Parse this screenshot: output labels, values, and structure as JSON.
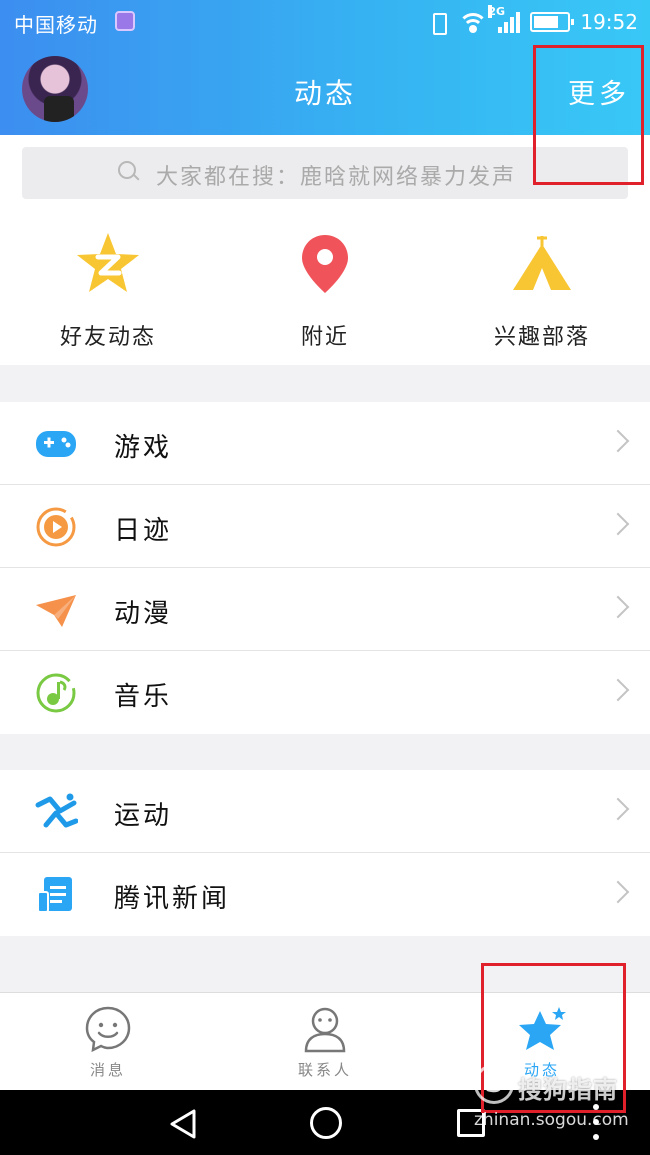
{
  "status_bar": {
    "carrier": "中国移动",
    "network": "2G",
    "time": "19:52"
  },
  "header": {
    "title": "动态",
    "more_label": "更多"
  },
  "search": {
    "placeholder": "大家都在搜：鹿晗就网络暴力发声"
  },
  "quick_entries": [
    {
      "label": "好友动态",
      "icon": "qzone-star-icon"
    },
    {
      "label": "附近",
      "icon": "location-pin-icon"
    },
    {
      "label": "兴趣部落",
      "icon": "tent-icon"
    }
  ],
  "menu_section_1": [
    {
      "label": "游戏",
      "icon": "gamepad-icon"
    },
    {
      "label": "日迹",
      "icon": "play-circle-icon"
    },
    {
      "label": "动漫",
      "icon": "paper-plane-icon"
    },
    {
      "label": "音乐",
      "icon": "music-note-icon"
    }
  ],
  "menu_section_2": [
    {
      "label": "运动",
      "icon": "running-icon"
    },
    {
      "label": "腾讯新闻",
      "icon": "news-icon"
    }
  ],
  "tab_bar": [
    {
      "label": "消息",
      "icon": "smile-chat-icon",
      "active": false
    },
    {
      "label": "联系人",
      "icon": "person-icon",
      "active": false
    },
    {
      "label": "动态",
      "icon": "star-icon",
      "active": true
    }
  ],
  "watermark": {
    "brand": "搜狗指南",
    "url": "zhinan.sogou.com"
  },
  "colors": {
    "header_gradient_start": "#3c8ef0",
    "header_gradient_end": "#38c8f6",
    "active_tab": "#2aa6f5",
    "highlight": "#e0202a"
  }
}
